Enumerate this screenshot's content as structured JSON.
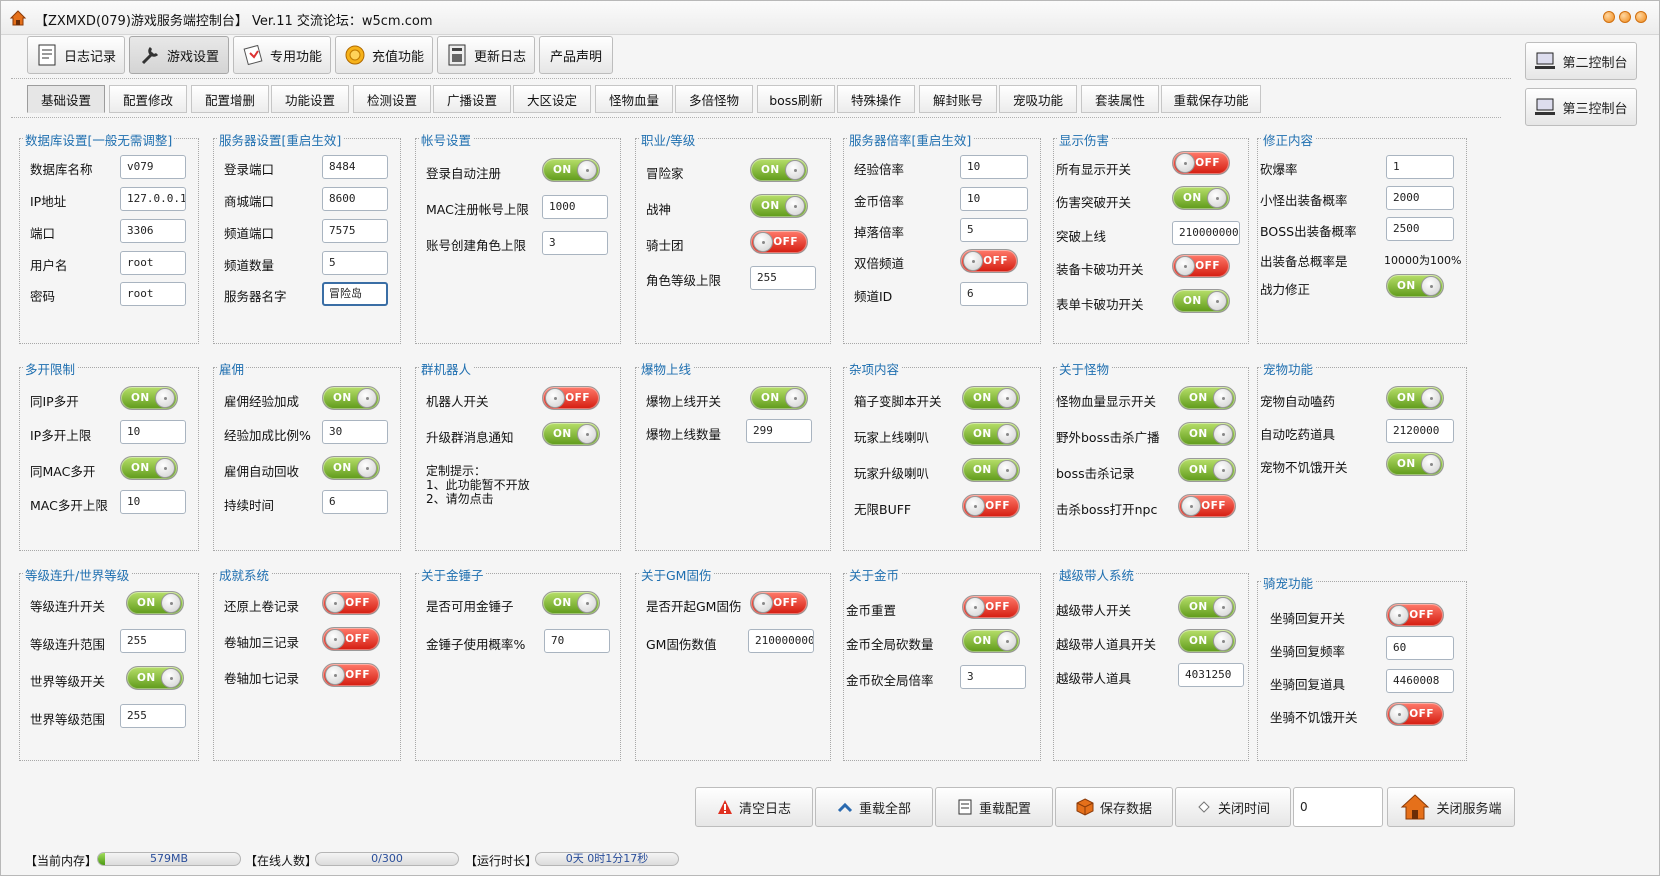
{
  "window": {
    "title": "【ZXMXD(079)游戏服务端控制台】 Ver.11 交流论坛：w5cm.com"
  },
  "top_buttons": [
    "日志记录",
    "游戏设置",
    "专用功能",
    "充值功能",
    "更新日志",
    "产品声明"
  ],
  "side_buttons": [
    "第二控制台",
    "第三控制台"
  ],
  "tabs": [
    "基础设置",
    "配置修改",
    "配置增删",
    "功能设置",
    "检测设置",
    "广播设置",
    "大区设定",
    "怪物血量",
    "多倍怪物",
    "boss刷新",
    "特殊操作",
    "解封账号",
    "宠吸功能",
    "套装属性",
    "重载保存功能"
  ],
  "groups": {
    "db": {
      "title": "数据库设置[一般无需调整]",
      "labels": [
        "数据库名称",
        "IP地址",
        "端口",
        "用户名",
        "密码"
      ],
      "values": [
        "v079",
        "127.0.0.1",
        "3306",
        "root",
        "root"
      ]
    },
    "server": {
      "title": "服务器设置[重启生效]",
      "labels": [
        "登录端口",
        "商城端口",
        "频道端口",
        "频道数量",
        "服务器名字"
      ],
      "values": [
        "8484",
        "8600",
        "7575",
        "5",
        "冒险岛"
      ]
    },
    "account": {
      "title": "帐号设置",
      "labels": [
        "登录自动注册",
        "MAC注册帐号上限",
        "账号创建角色上限"
      ],
      "switch": "ON",
      "values": [
        "1000",
        "3"
      ]
    },
    "job": {
      "title": "职业/等级",
      "labels": [
        "冒险家",
        "战神",
        "骑士团",
        "角色等级上限"
      ],
      "switches": [
        "ON",
        "ON",
        "OFF"
      ],
      "value": "255"
    },
    "rate": {
      "title": "服务器倍率[重启生效]",
      "labels": [
        "经验倍率",
        "金币倍率",
        "掉落倍率",
        "双倍频道",
        "频道ID"
      ],
      "values": [
        "10",
        "10",
        "5",
        "6"
      ],
      "switch": "OFF"
    },
    "dmg": {
      "title": "显示伤害",
      "labels": [
        "所有显示开关",
        "伤害突破开关",
        "突破上线",
        "装备卡破功开关",
        "表单卡破功开关"
      ],
      "switches": [
        "OFF",
        "ON",
        "OFF",
        "ON"
      ],
      "value": "2100000000"
    },
    "fix": {
      "title": "修正内容",
      "labels": [
        "砍爆率",
        "小怪出装备概率",
        "BOSS出装备概率",
        "出装备总概率是",
        "战力修正"
      ],
      "values": [
        "1",
        "2000",
        "2500"
      ],
      "text": "10000为100%",
      "switch": "ON"
    },
    "multi": {
      "title": "多开限制",
      "labels": [
        "同IP多开",
        "IP多开上限",
        "同MAC多开",
        "MAC多开上限"
      ],
      "switches": [
        "ON",
        "ON"
      ],
      "values": [
        "10",
        "10"
      ]
    },
    "hire": {
      "title": "雇佣",
      "labels": [
        "雇佣经验加成",
        "经验加成比例%",
        "雇佣自动回收",
        "持续时间"
      ],
      "switches": [
        "ON",
        "ON"
      ],
      "values": [
        "30",
        "6"
      ]
    },
    "bot": {
      "title": "群机器人",
      "labels": [
        "机器人开关",
        "升级群消息通知"
      ],
      "switches": [
        "OFF",
        "ON"
      ],
      "note": "定制提示：\n1、此功能暂不开放\n2、请勿点击"
    },
    "drop": {
      "title": "爆物上线",
      "labels": [
        "爆物上线开关",
        "爆物上线数量"
      ],
      "switch": "ON",
      "value": "299"
    },
    "misc": {
      "title": "杂项内容",
      "labels": [
        "箱子变脚本开关",
        "玩家上线喇叭",
        "玩家升级喇叭",
        "无限BUFF"
      ],
      "switches": [
        "ON",
        "ON",
        "ON",
        "OFF"
      ]
    },
    "monster": {
      "title": "关于怪物",
      "labels": [
        "怪物血量显示开关",
        "野外boss击杀广播",
        "boss击杀记录",
        "击杀boss打开npc"
      ],
      "switches": [
        "ON",
        "ON",
        "ON",
        "OFF"
      ]
    },
    "pet": {
      "title": "宠物功能",
      "labels": [
        "宠物自动嗑药",
        "自动吃药道具",
        "宠物不饥饿开关"
      ],
      "switches": [
        "ON",
        "ON"
      ],
      "value": "2120000"
    },
    "level": {
      "title": "等级连升/世界等级",
      "labels": [
        "等级连升开关",
        "等级连升范围",
        "世界等级开关",
        "世界等级范围"
      ],
      "switches": [
        "ON",
        "ON"
      ],
      "values": [
        "255",
        "255"
      ]
    },
    "achieve": {
      "title": "成就系统",
      "labels": [
        "还原上卷记录",
        "卷轴加三记录",
        "卷轴加七记录"
      ],
      "switches": [
        "OFF",
        "OFF",
        "OFF"
      ]
    },
    "hammer": {
      "title": "关于金锤子",
      "labels": [
        "是否可用金锤子",
        "金锤子使用概率%"
      ],
      "switch": "ON",
      "value": "70"
    },
    "gm": {
      "title": "关于GM固伤",
      "labels": [
        "是否开起GM固伤",
        "GM固伤数值"
      ],
      "switch": "OFF",
      "value": "2100000000"
    },
    "gold": {
      "title": "关于金币",
      "labels": [
        "金币重置",
        "金币全局砍数量",
        "金币砍全局倍率"
      ],
      "switches": [
        "OFF",
        "ON"
      ],
      "value": "3"
    },
    "carry": {
      "title": "越级带人系统",
      "labels": [
        "越级带人开关",
        "越级带人道具开关",
        "越级带人道具"
      ],
      "switches": [
        "ON",
        "ON"
      ],
      "value": "4031250"
    },
    "mount": {
      "title": "骑宠功能",
      "labels": [
        "坐骑回复开关",
        "坐骑回复频率",
        "坐骑回复道具",
        "坐骑不饥饿开关"
      ],
      "switches": [
        "OFF",
        "OFF"
      ],
      "values": [
        "60",
        "4460008"
      ]
    }
  },
  "status": {
    "mem_label": "【当前内存】",
    "mem_value": "579MB",
    "mem_fill": 0.05,
    "online_label": "【在线人数】",
    "online_value": "0/300",
    "online_fill": 0,
    "uptime_label": "【运行时长】",
    "uptime_value": "0天 0时1分17秒",
    "uptime_fill": 0
  },
  "bottom_buttons": [
    "清空日志",
    "重载全部",
    "重载配置",
    "保存数据",
    "关闭时间",
    "关闭服务端"
  ],
  "bottom_input": "0",
  "colors": {
    "on": "#7cbf2a",
    "off": "#e8271a",
    "group_title": "#1f6fb0"
  },
  "icons": [
    "app-icon",
    "log-icon",
    "tool-icon",
    "special-icon",
    "coin-icon",
    "update-icon",
    "computer-icon",
    "warning-icon",
    "reload-icon",
    "config-icon",
    "save-icon",
    "clock-icon",
    "house-icon"
  ]
}
